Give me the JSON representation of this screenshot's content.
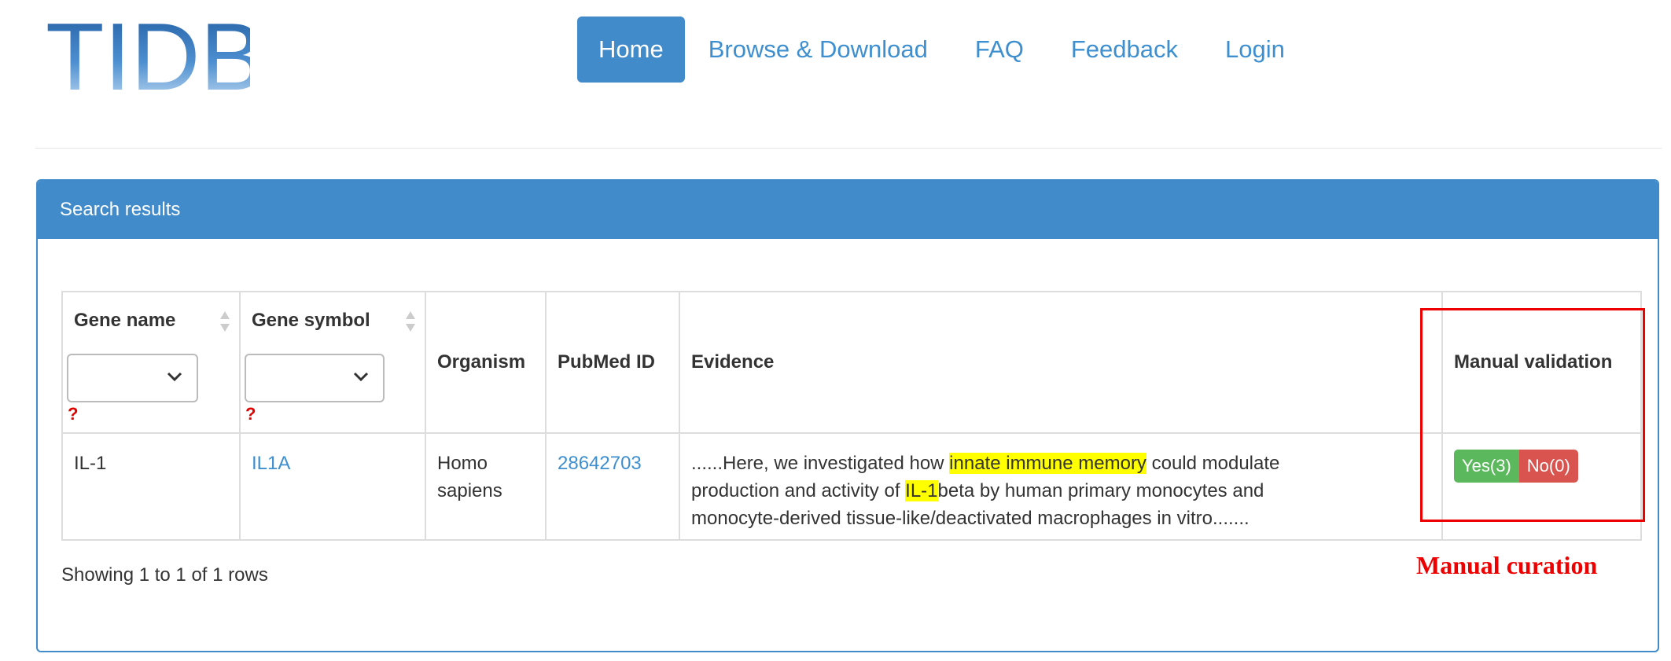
{
  "logo": {
    "text": "TIDB",
    "color": "#3a77b8"
  },
  "nav": {
    "items": [
      {
        "label": "Home",
        "active": true
      },
      {
        "label": "Browse & Download",
        "active": false
      },
      {
        "label": "FAQ",
        "active": false
      },
      {
        "label": "Feedback",
        "active": false
      },
      {
        "label": "Login",
        "active": false
      }
    ]
  },
  "panel": {
    "heading": "Search results"
  },
  "table": {
    "headers": {
      "gene_name": "Gene name",
      "gene_symbol": "Gene symbol",
      "organism": "Organism",
      "pubmed_id": "PubMed ID",
      "evidence": "Evidence",
      "manual_validation": "Manual validation"
    },
    "filter_help": "?",
    "rows": [
      {
        "gene_name": "IL-1",
        "gene_symbol": "IL1A",
        "organism_line1": "Homo",
        "organism_line2": "sapiens",
        "pubmed_id": "28642703",
        "evidence": {
          "part1": "......Here, we investigated how ",
          "highlight1": "innate immune memory",
          "part2": " could modulate",
          "part3": "production and activity of ",
          "highlight2": "IL-1",
          "part4": "beta by human primary monocytes and",
          "part5": "monocyte-derived tissue-like/deactivated macrophages in vitro......."
        },
        "yes_label": "Yes(3)",
        "no_label": "No(0)"
      }
    ]
  },
  "footer": {
    "showing": "Showing 1 to 1 of 1 rows"
  },
  "annotation": {
    "label": "Manual curation",
    "color": "#ee0000"
  },
  "colors": {
    "primary": "#428bca",
    "link": "#3e8fd0",
    "yes": "#5cb85c",
    "no": "#d9534f",
    "highlight": "#ffff00"
  }
}
